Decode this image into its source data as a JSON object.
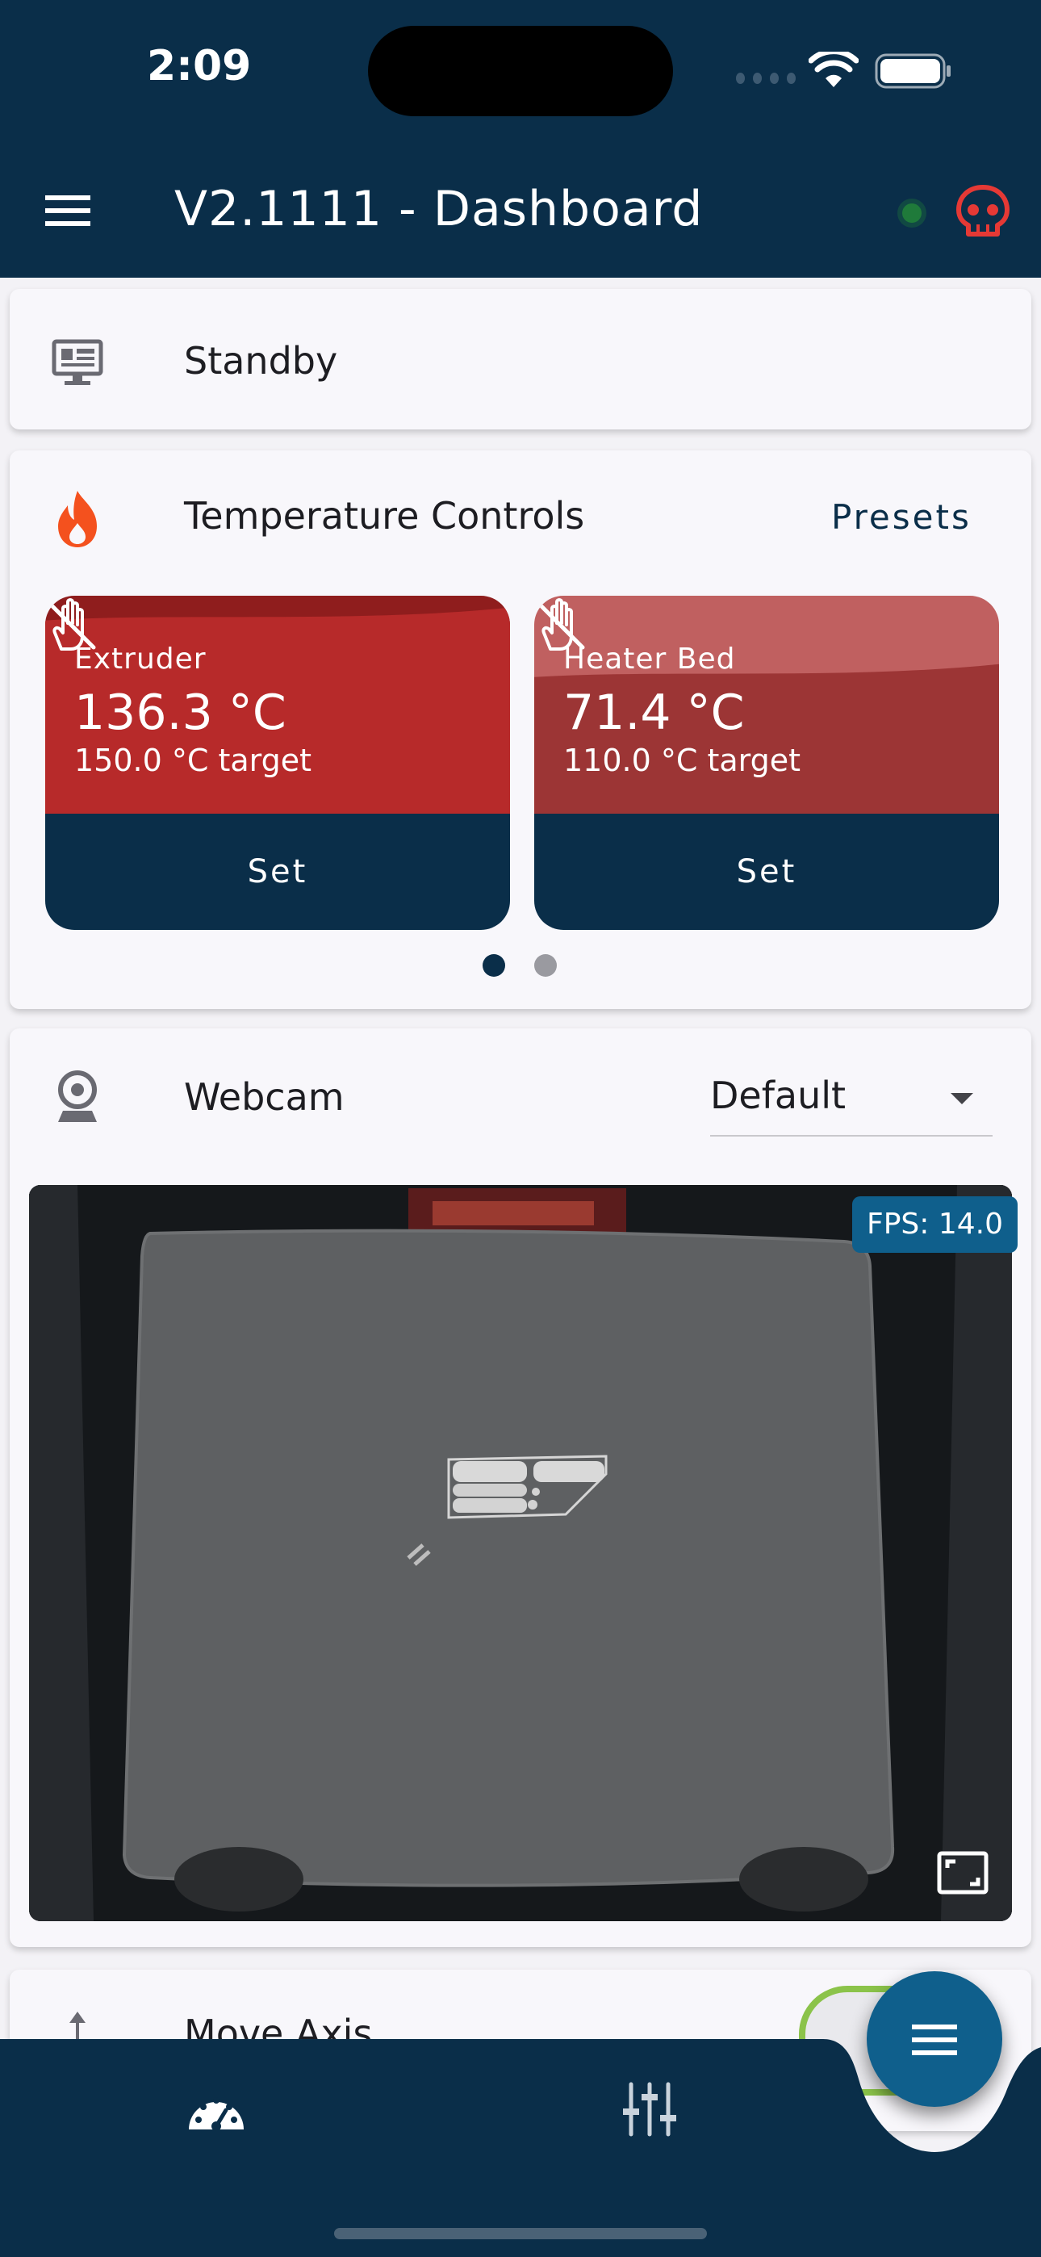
{
  "status_bar": {
    "time": "2:09"
  },
  "header": {
    "title": "V2.1111 - Dashboard"
  },
  "standby": {
    "label": "Standby"
  },
  "temperature": {
    "title": "Temperature Controls",
    "presets_label": "Presets",
    "heaters": [
      {
        "name": "Extruder",
        "current": "136.3 °C",
        "target": "150.0 °C target",
        "set_label": "Set",
        "progress": 0.909
      },
      {
        "name": "Heater Bed",
        "current": "71.4 °C",
        "target": "110.0 °C target",
        "set_label": "Set",
        "progress": 0.649
      }
    ],
    "page_count": 2,
    "active_page": 1
  },
  "webcam": {
    "title": "Webcam",
    "selected": "Default",
    "fps": "FPS: 14.0"
  },
  "move_axis": {
    "title": "Move Axis"
  },
  "colors": {
    "header_bg": "#0a2e49",
    "heater_dark": "#8f1d1d",
    "heater_fill": "#b72a2a",
    "accent_blue": "#0f5f8c",
    "flame_orange": "#f4511e",
    "status_green": "#1f7a3a",
    "alert_red": "#e53935"
  },
  "icons": [
    "menu-icon",
    "skull-icon",
    "monitor-icon",
    "flame-icon",
    "hand-off-icon",
    "webcam-icon",
    "fullscreen-icon",
    "dashboard-icon",
    "sliders-icon",
    "menu-fab-icon"
  ]
}
